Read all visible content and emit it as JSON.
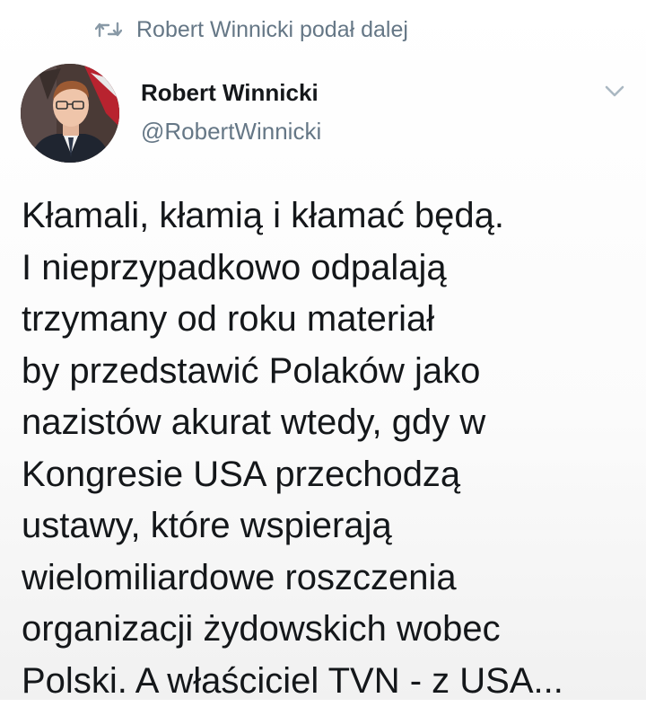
{
  "retweet_notice": {
    "icon": "retweet-icon",
    "label": "Robert Winnicki podał dalej"
  },
  "tweet": {
    "author": {
      "name": "Robert Winnicki",
      "handle": "@RobertWinnicki",
      "avatar_icon": "avatar-photo"
    },
    "menu_icon": "chevron-down-icon",
    "text_lines": [
      "Kłamali, kłamią i kłamać będą.",
      "I nieprzypadkowo odpalają",
      "trzymany od roku materiał",
      "by przedstawić Polaków jako",
      "nazistów akurat wtedy, gdy w",
      "Kongresie USA przechodzą",
      "ustawy, które wspierają",
      "wielomiliardowe roszczenia",
      "organizacji żydowskich wobec",
      "Polski. A właściciel TVN - z USA..."
    ]
  },
  "colors": {
    "text_primary": "#14171a",
    "text_secondary": "#657786",
    "background": "#ffffff"
  }
}
